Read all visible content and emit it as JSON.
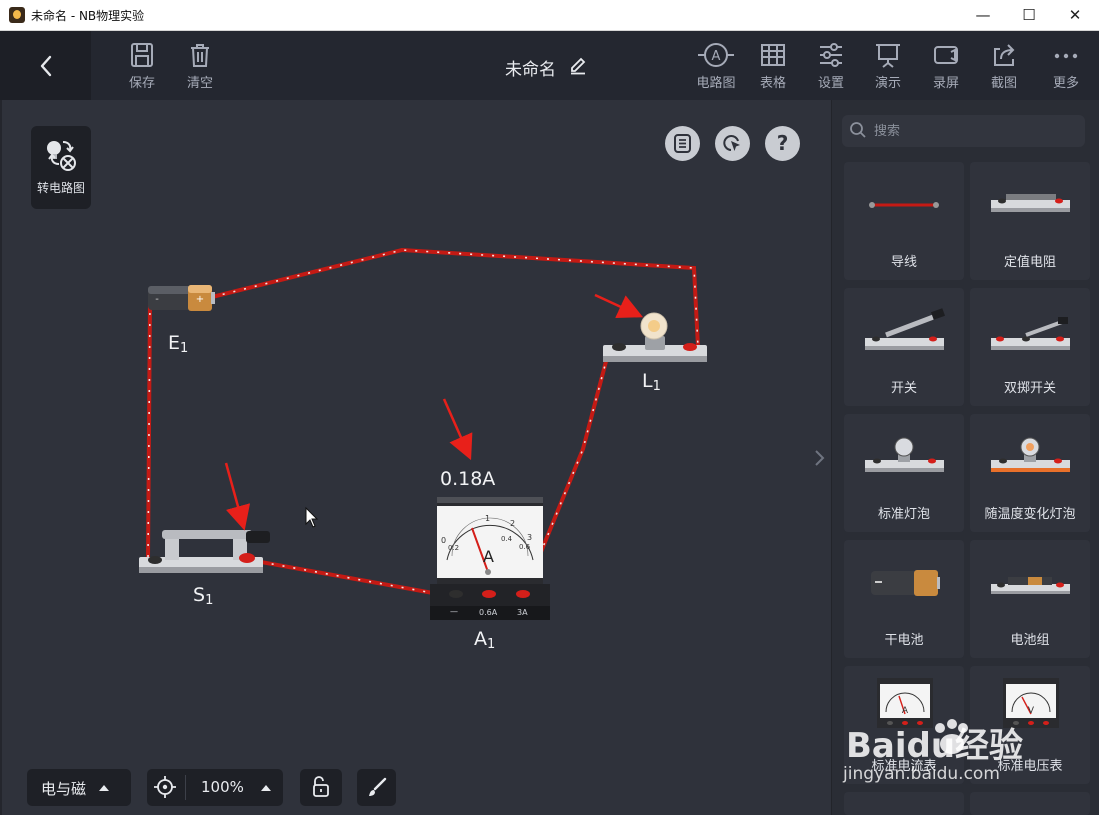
{
  "window": {
    "title": "未命名 - NB物理实验",
    "minimize": "—",
    "maximize": "☐",
    "close": "✕"
  },
  "toolbar": {
    "save": "保存",
    "clear": "清空",
    "doc_title": "未命名",
    "circuit_diagram": "电路图",
    "table": "表格",
    "settings": "设置",
    "present": "演示",
    "record": "录屏",
    "screenshot": "截图",
    "more": "更多"
  },
  "canvas": {
    "convert_label": "转电路图",
    "ammeter_reading": "0.18A",
    "labels": {
      "battery": {
        "name": "E",
        "sub": "1"
      },
      "lamp": {
        "name": "L",
        "sub": "1"
      },
      "switch": {
        "name": "S",
        "sub": "1"
      },
      "ammeter": {
        "name": "A",
        "sub": "1"
      }
    },
    "ammeter_terminals": [
      "—",
      "0.6A",
      "3A"
    ],
    "ammeter_unit": "A",
    "ammeter_scale": [
      "0",
      "0.2",
      "0.4",
      "0.6",
      "1",
      "2",
      "3"
    ]
  },
  "bottom": {
    "category": "电与磁",
    "zoom": "100%"
  },
  "palette": {
    "search_placeholder": "搜索",
    "items": [
      {
        "label": "导线",
        "icon": "wire-icon"
      },
      {
        "label": "定值电阻",
        "icon": "resistor-icon"
      },
      {
        "label": "开关",
        "icon": "switch-icon"
      },
      {
        "label": "双掷开关",
        "icon": "double-throw-switch-icon"
      },
      {
        "label": "标准灯泡",
        "icon": "bulb-icon"
      },
      {
        "label": "随温度变化灯泡",
        "icon": "thermal-bulb-icon"
      },
      {
        "label": "干电池",
        "icon": "battery-icon"
      },
      {
        "label": "电池组",
        "icon": "battery-pack-icon"
      },
      {
        "label": "标准电流表",
        "icon": "ammeter-icon"
      },
      {
        "label": "标准电压表",
        "icon": "voltmeter-icon"
      }
    ]
  },
  "watermark": {
    "brand": "Baidu经验",
    "url": "jingyan.baidu.com"
  },
  "colors": {
    "wire": "#c41a14",
    "arrow": "#e8201a",
    "toolbar_bg": "#242730",
    "canvas_bg": "#2f323b"
  }
}
